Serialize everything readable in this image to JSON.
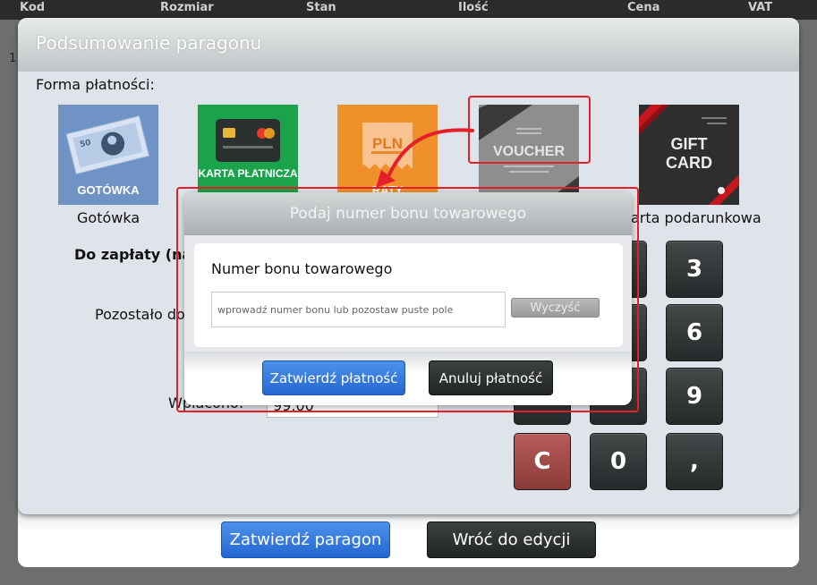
{
  "background_table": {
    "columns": [
      "Kod",
      "Rozmiar",
      "Stan",
      "Ilość",
      "Cena",
      "VAT"
    ],
    "row_fragment": "1"
  },
  "summary": {
    "title": "Podsumowanie paragonu",
    "payment_method_label": "Forma płatności:",
    "methods": [
      {
        "tile_text": "GOTÓWKA",
        "label": "Gotówka",
        "color": "#6f93c4"
      },
      {
        "tile_text": "KARTA PŁATNICZA",
        "label": "",
        "color": "#1aa34a"
      },
      {
        "tile_text": "RATY",
        "sub_text": "PLN",
        "label": "",
        "color": "#f0902a"
      },
      {
        "tile_text": "VOUCHER",
        "label": "",
        "color": "#7d7d7d"
      },
      {
        "tile_text": "GIFT CARD",
        "label": "Karta podarunkowa",
        "label_visible": "arta podarunkowa",
        "color": "#2e2e2e"
      }
    ],
    "to_pay_label": "Do zapłaty (na",
    "remaining_label": "Pozostało do",
    "paid_label": "Wpłacono:",
    "paid_value": "99,00",
    "keypad": [
      "3",
      "6",
      "9",
      "C",
      "0",
      ","
    ],
    "confirm_receipt": "Zatwierdź paragon",
    "back_to_edit": "Wróć do edycji"
  },
  "voucher_modal": {
    "title": "Podaj numer bonu towarowego",
    "field_label": "Numer bonu towarowego",
    "placeholder": "wprowadź numer bonu lub pozostaw puste pole",
    "value": "",
    "clear_label": "Wyczyść",
    "confirm_label": "Zatwierdź płatność",
    "cancel_label": "Anuluj płatność"
  },
  "colors": {
    "highlight": "#e3202a",
    "primary_button": "#2f74dc",
    "dark_button": "#2b2f30",
    "clear_key": "#a04846"
  }
}
